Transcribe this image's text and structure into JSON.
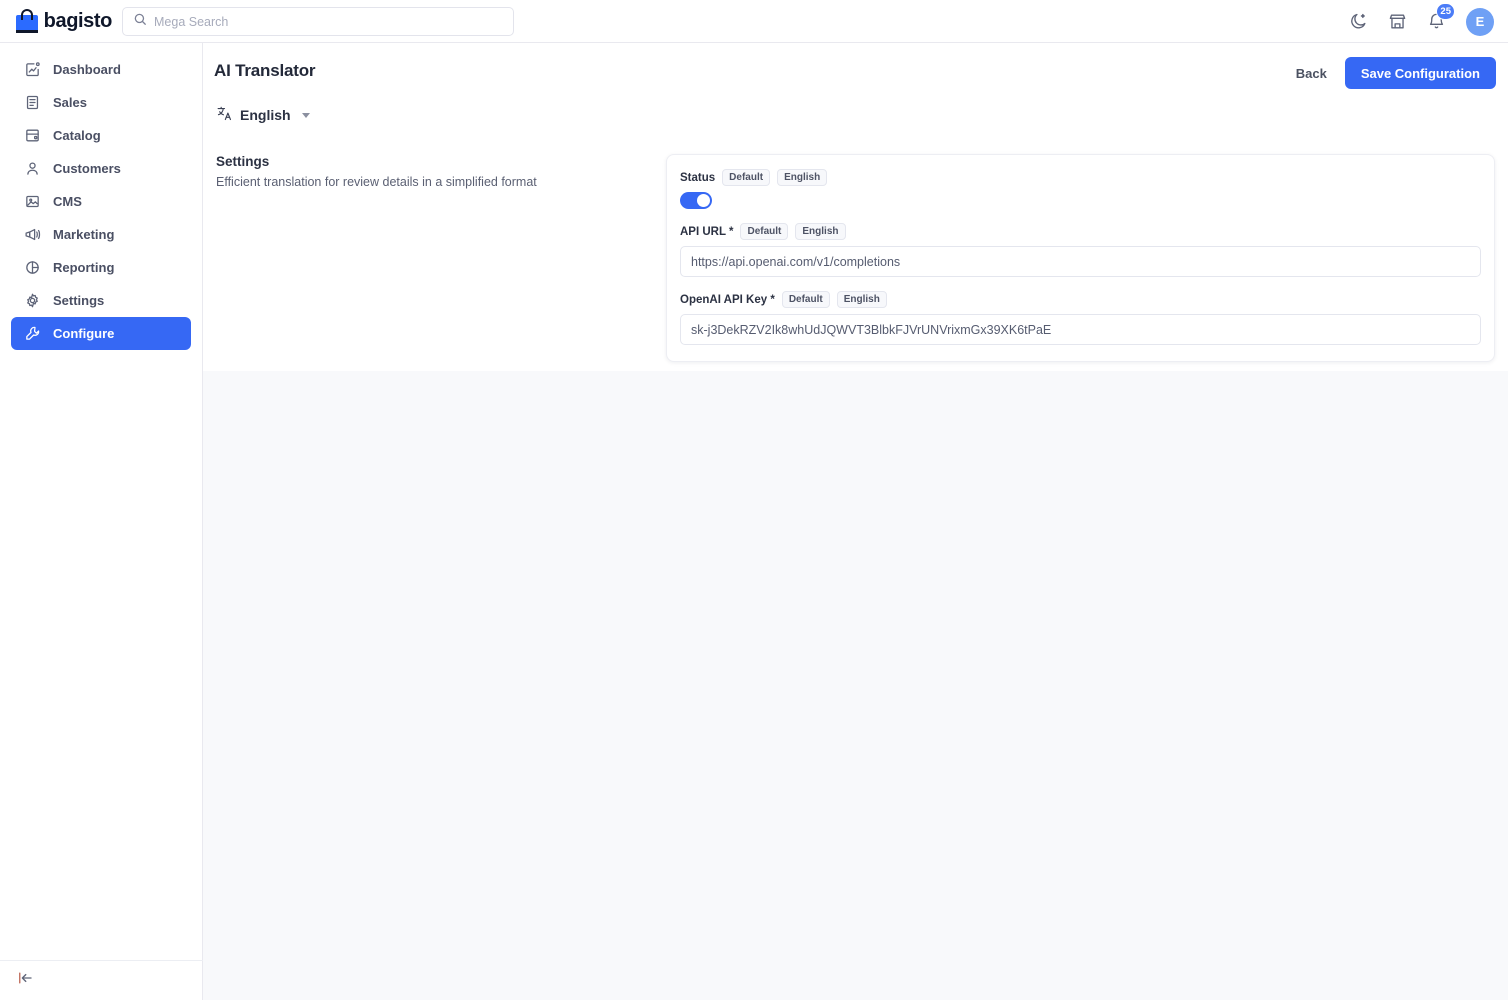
{
  "header": {
    "brand_name": "bagisto",
    "brand_icon": "shopping-bag-icon",
    "search": {
      "placeholder": "Mega Search",
      "value": "",
      "icon": "search-icon"
    },
    "actions": [
      {
        "name": "dark-mode-toggle",
        "icon": "moon-icon"
      },
      {
        "name": "storefront-link",
        "icon": "store-icon"
      },
      {
        "name": "notifications",
        "icon": "bell-icon",
        "badge": "25"
      }
    ],
    "avatar_initial": "E"
  },
  "sidebar": {
    "items": [
      {
        "label": "Dashboard",
        "icon": "dashboard-icon",
        "active": false
      },
      {
        "label": "Sales",
        "icon": "sales-icon",
        "active": false
      },
      {
        "label": "Catalog",
        "icon": "catalog-icon",
        "active": false
      },
      {
        "label": "Customers",
        "icon": "customers-icon",
        "active": false
      },
      {
        "label": "CMS",
        "icon": "cms-icon",
        "active": false
      },
      {
        "label": "Marketing",
        "icon": "marketing-icon",
        "active": false
      },
      {
        "label": "Reporting",
        "icon": "reporting-icon",
        "active": false
      },
      {
        "label": "Settings",
        "icon": "settings-icon",
        "active": false
      },
      {
        "label": "Configure",
        "icon": "configure-icon",
        "active": true
      }
    ],
    "collapse_icon": "collapse-sidebar-icon"
  },
  "page": {
    "title": "AI Translator",
    "back_label": "Back",
    "save_label": "Save Configuration",
    "language": {
      "label": "English",
      "icon": "translate-icon"
    },
    "settings_section": {
      "title": "Settings",
      "description": "Efficient translation for review details in a simplified format"
    },
    "fields": [
      {
        "label": "Status",
        "required": false,
        "chips": [
          "Default",
          "English"
        ],
        "type": "toggle",
        "value": "on"
      },
      {
        "label": "API URL",
        "required": true,
        "required_mark": "*",
        "chips": [
          "Default",
          "English"
        ],
        "type": "text",
        "value": "https://api.openai.com/v1/completions",
        "placeholder": ""
      },
      {
        "label": "OpenAI API Key",
        "required": true,
        "required_mark": "*",
        "chips": [
          "Default",
          "English"
        ],
        "type": "text",
        "value": "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",
        "placeholder": ""
      }
    ]
  },
  "colors": {
    "accent": "#3668f4",
    "badge": "#4b7cf7",
    "avatar": "#6fa0f5",
    "page_bg": "#f8f9fb",
    "panel_bg": "#ffffff"
  }
}
